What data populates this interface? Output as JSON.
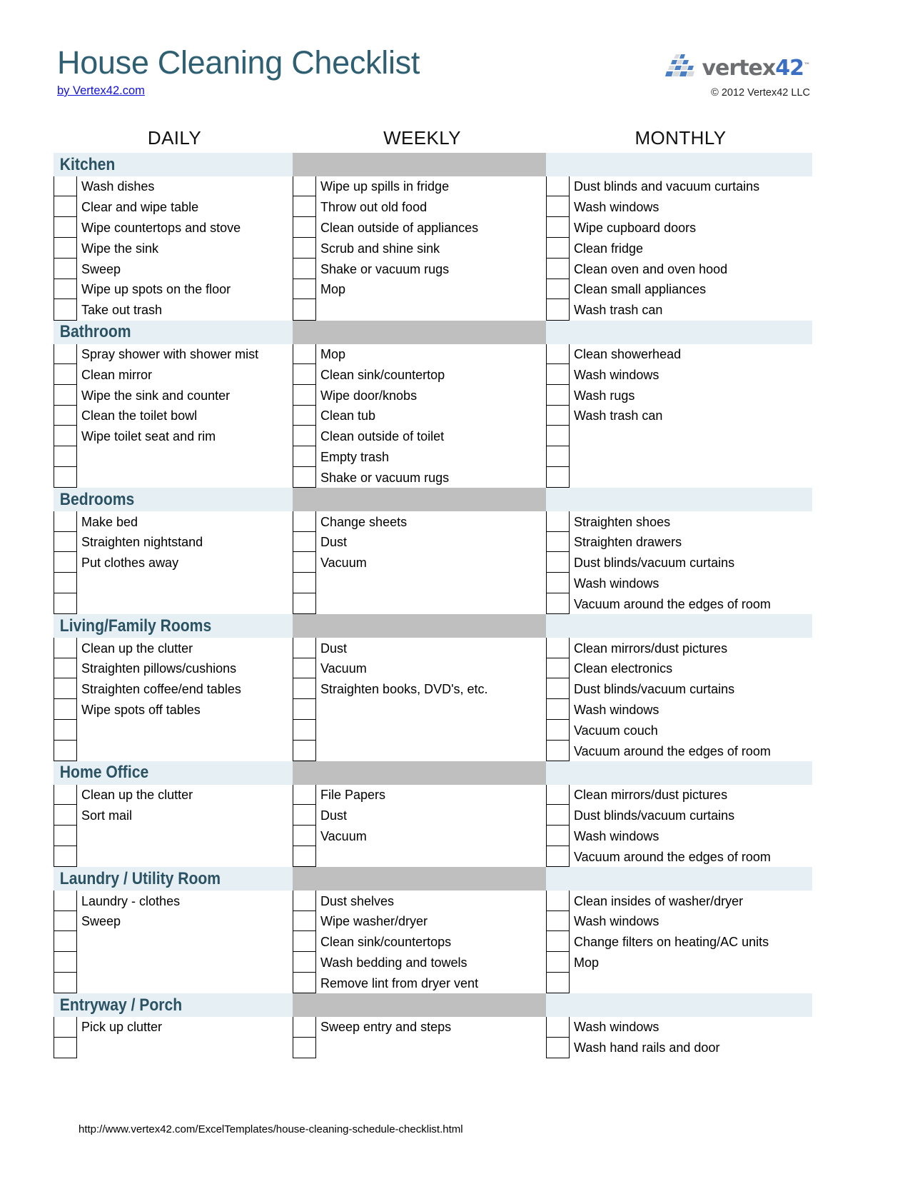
{
  "document": {
    "title": "House Cleaning Checklist",
    "byline": "by Vertex42.com",
    "copyright": "© 2012 Vertex42 LLC",
    "footer_url": "http://www.vertex42.com/ExcelTemplates/house-cleaning-schedule-checklist.html"
  },
  "brand": {
    "logo_icon": "vertex42-tiles-icon",
    "name_part1": "vertex",
    "name_part2": "42",
    "trademark": "™"
  },
  "colors": {
    "title_teal": "#2e5f73",
    "section_header_blue": "#e5eff4",
    "section_band_gray": "#bfbfbf",
    "link_blue": "#1111dd",
    "section_title_teal": "#2b5263"
  },
  "columns": [
    {
      "key": "daily",
      "label": "DAILY"
    },
    {
      "key": "weekly",
      "label": "WEEKLY"
    },
    {
      "key": "monthly",
      "label": "MONTHLY"
    }
  ],
  "sections": [
    {
      "title": "Kitchen",
      "rows": 7,
      "daily": [
        "Wash dishes",
        "Clear and wipe table",
        "Wipe countertops and stove",
        "Wipe the sink",
        "Sweep",
        "Wipe up spots on the floor",
        "Take out trash"
      ],
      "weekly": [
        "Wipe up spills in fridge",
        "Throw out old food",
        "Clean outside of appliances",
        "Scrub and shine sink",
        "Shake or vacuum rugs",
        "Mop",
        ""
      ],
      "monthly": [
        "Dust blinds and vacuum curtains",
        "Wash windows",
        "Wipe cupboard doors",
        "Clean fridge",
        "Clean oven and oven hood",
        "Clean small appliances",
        "Wash trash can"
      ]
    },
    {
      "title": "Bathroom",
      "rows": 7,
      "daily": [
        "Spray shower with shower mist",
        "Clean mirror",
        "Wipe the sink and counter",
        "Clean the toilet bowl",
        "Wipe toilet seat and rim",
        "",
        ""
      ],
      "weekly": [
        "Mop",
        "Clean sink/countertop",
        "Wipe door/knobs",
        "Clean tub",
        "Clean outside of toilet",
        "Empty trash",
        "Shake or vacuum rugs"
      ],
      "monthly": [
        "Clean showerhead",
        "Wash windows",
        "Wash rugs",
        "Wash trash can",
        "",
        "",
        ""
      ]
    },
    {
      "title": "Bedrooms",
      "rows": 5,
      "daily": [
        "Make bed",
        "Straighten nightstand",
        "Put clothes away",
        "",
        ""
      ],
      "weekly": [
        "Change sheets",
        "Dust",
        "Vacuum",
        "",
        ""
      ],
      "monthly": [
        "Straighten shoes",
        "Straighten drawers",
        "Dust blinds/vacuum curtains",
        "Wash windows",
        "Vacuum around the edges of room"
      ]
    },
    {
      "title": "Living/Family Rooms",
      "rows": 6,
      "daily": [
        "Clean up the clutter",
        "Straighten pillows/cushions",
        "Straighten coffee/end tables",
        "Wipe spots off tables",
        "",
        ""
      ],
      "weekly": [
        "Dust",
        "Vacuum",
        "Straighten books, DVD's, etc.",
        "",
        "",
        ""
      ],
      "monthly": [
        "Clean mirrors/dust pictures",
        "Clean electronics",
        "Dust blinds/vacuum curtains",
        "Wash windows",
        "Vacuum couch",
        "Vacuum around the edges of room"
      ]
    },
    {
      "title": "Home Office",
      "rows": 4,
      "daily": [
        "Clean up the clutter",
        "Sort mail",
        "",
        ""
      ],
      "weekly": [
        "File Papers",
        "Dust",
        "Vacuum",
        ""
      ],
      "monthly": [
        "Clean mirrors/dust pictures",
        "Dust blinds/vacuum curtains",
        "Wash windows",
        "Vacuum around the edges of room"
      ]
    },
    {
      "title": "Laundry / Utility Room",
      "rows": 5,
      "daily": [
        "Laundry - clothes",
        "Sweep",
        "",
        "",
        ""
      ],
      "weekly": [
        "Dust shelves",
        "Wipe washer/dryer",
        "Clean sink/countertops",
        "Wash bedding and towels",
        "Remove lint from dryer vent"
      ],
      "monthly": [
        "Clean insides of washer/dryer",
        "Wash windows",
        "Change filters on heating/AC units",
        "Mop",
        ""
      ]
    },
    {
      "title": "Entryway / Porch",
      "rows": 2,
      "daily": [
        "Pick up clutter",
        ""
      ],
      "weekly": [
        "Sweep entry and steps",
        ""
      ],
      "monthly": [
        "Wash windows",
        "Wash hand rails and door"
      ]
    }
  ]
}
